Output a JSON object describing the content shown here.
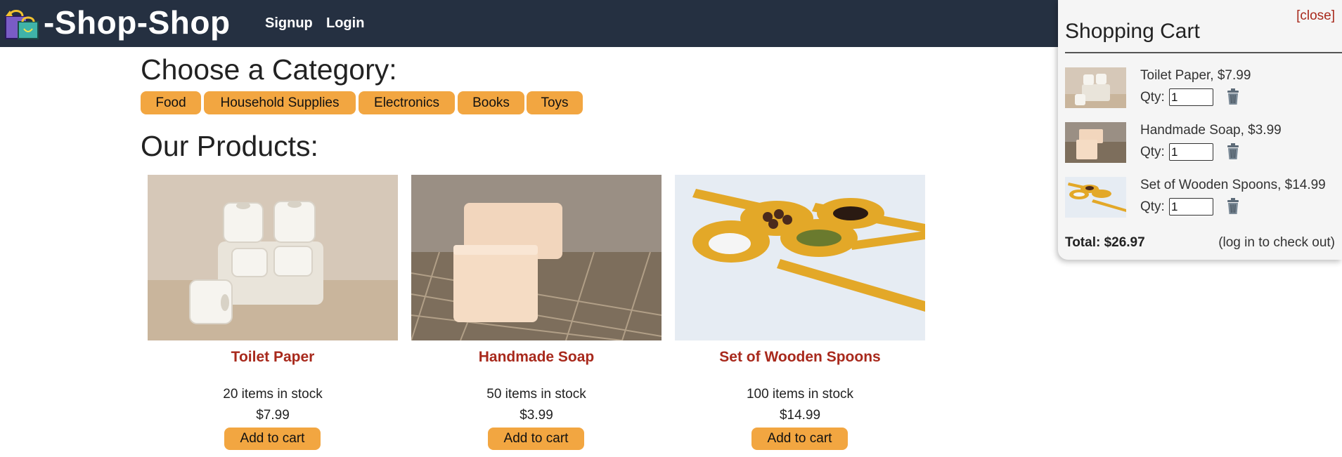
{
  "header": {
    "brand": "-Shop-Shop",
    "nav": [
      {
        "label": "Signup"
      },
      {
        "label": "Login"
      }
    ]
  },
  "categories": {
    "heading": "Choose a Category:",
    "items": [
      "Food",
      "Household Supplies",
      "Electronics",
      "Books",
      "Toys"
    ]
  },
  "products": {
    "heading": "Our Products:",
    "items": [
      {
        "name": "Toilet Paper",
        "stock": "20 items in stock",
        "price": "$7.99",
        "button": "Add to cart"
      },
      {
        "name": "Handmade Soap",
        "stock": "50 items in stock",
        "price": "$3.99",
        "button": "Add to cart"
      },
      {
        "name": "Set of Wooden Spoons",
        "stock": "100 items in stock",
        "price": "$14.99",
        "button": "Add to cart"
      }
    ]
  },
  "cart": {
    "close": "[close]",
    "title": "Shopping Cart",
    "qty_label": "Qty:",
    "items": [
      {
        "text": "Toilet Paper, $7.99",
        "qty": "1"
      },
      {
        "text": "Handmade Soap, $3.99",
        "qty": "1"
      },
      {
        "text": "Set of Wooden Spoons, $14.99",
        "qty": "1"
      }
    ],
    "total": "Total: $26.97",
    "checkout_note": "(log in to check out)"
  },
  "colors": {
    "header_bg": "#253041",
    "accent": "#f2a641",
    "product_name": "#a8291c"
  }
}
